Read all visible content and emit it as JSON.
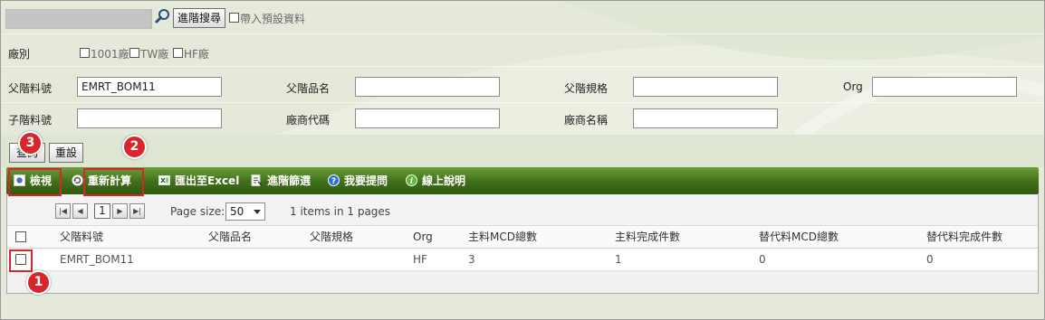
{
  "top": {
    "advanced_search_label": "進階搜尋",
    "include_default_label": "帶入預設資料"
  },
  "filters": {
    "factory_label": "廠別",
    "factory_options": [
      "1001廠",
      "TW廠",
      "HF廠"
    ],
    "parent_part_no_label": "父階料號",
    "parent_part_no_value": "EMRT_BOM11",
    "parent_name_label": "父階品名",
    "parent_spec_label": "父階規格",
    "org_label": "Org",
    "child_part_no_label": "子階料號",
    "vendor_code_label": "廠商代碼",
    "vendor_name_label": "廠商名稱"
  },
  "actions": {
    "query_label": "查詢",
    "reset_label": "重設"
  },
  "toolbar": {
    "view": "檢視",
    "recalc": "重新計算",
    "export": "匯出至Excel",
    "adv_filter": "進階篩選",
    "ask": "我要提問",
    "help": "線上說明"
  },
  "pager": {
    "current_page": "1",
    "page_size_label": "Page size:",
    "page_size_value": "50",
    "summary": "1 items in 1 pages"
  },
  "table": {
    "columns": [
      "父階料號",
      "父階品名",
      "父階規格",
      "Org",
      "主料MCD總數",
      "主料完成件數",
      "替代料MCD總數",
      "替代料完成件數"
    ],
    "rows": [
      [
        "EMRT_BOM11",
        "",
        "",
        "HF",
        "3",
        "1",
        "0",
        "0"
      ]
    ]
  },
  "annotations": [
    "1",
    "2",
    "3"
  ],
  "colors": {
    "toolbar_green": "#3f6e1a",
    "marker_red": "#d8262a",
    "panel_bg": "#e4e9da"
  },
  "icons": [
    "search-icon",
    "view-icon",
    "recalc-icon",
    "excel-icon",
    "filter-icon",
    "help-question-icon",
    "info-icon"
  ]
}
